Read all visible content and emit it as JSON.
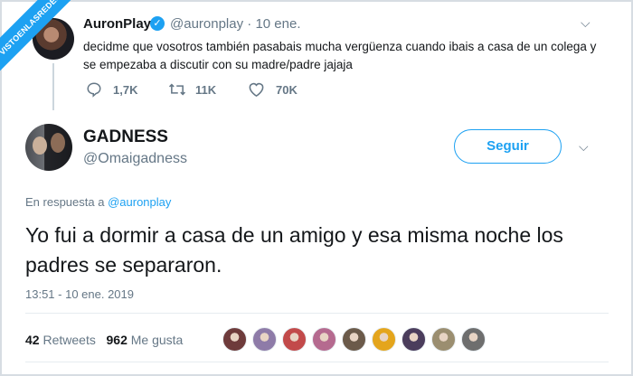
{
  "watermark": "VISTOENLASREDES",
  "quoted_tweet": {
    "name": "AuronPlay",
    "handle": "@auronplay",
    "date": "· 10 ene.",
    "text": "decidme que vosotros también pasabais mucha vergüenza cuando ibais a casa de un colega y se empezaba a discutir con su madre/padre jajaja",
    "replies": "1,7K",
    "retweets": "11K",
    "likes": "70K"
  },
  "main_tweet": {
    "name": "GADNESS",
    "handle": "@Omaigadness",
    "follow_label": "Seguir",
    "reply_prefix": "En respuesta a",
    "reply_to": "@auronplay",
    "text": "Yo fui a dormir a casa de un amigo y esa misma noche los padres se separaron.",
    "timestamp": "13:51 - 10 ene. 2019",
    "retweet_count": "42",
    "retweet_label": "Retweets",
    "like_count": "962",
    "like_label": "Me gusta"
  },
  "icons": {
    "verified": "verified-badge-icon",
    "reply": "reply-icon",
    "retweet": "retweet-icon",
    "like": "heart-icon",
    "caret": "chevron-down-icon"
  },
  "colors": {
    "accent": "#1da1f2",
    "secondary_text": "#657786",
    "primary_text": "#14171a"
  },
  "liker_avatar_colors": [
    "#6e3b3b",
    "#8e7ba8",
    "#c24a4a",
    "#b56a8f",
    "#6b5a4a",
    "#e4a51c",
    "#4b3d5c",
    "#9b8e70",
    "#6e6e6e"
  ]
}
